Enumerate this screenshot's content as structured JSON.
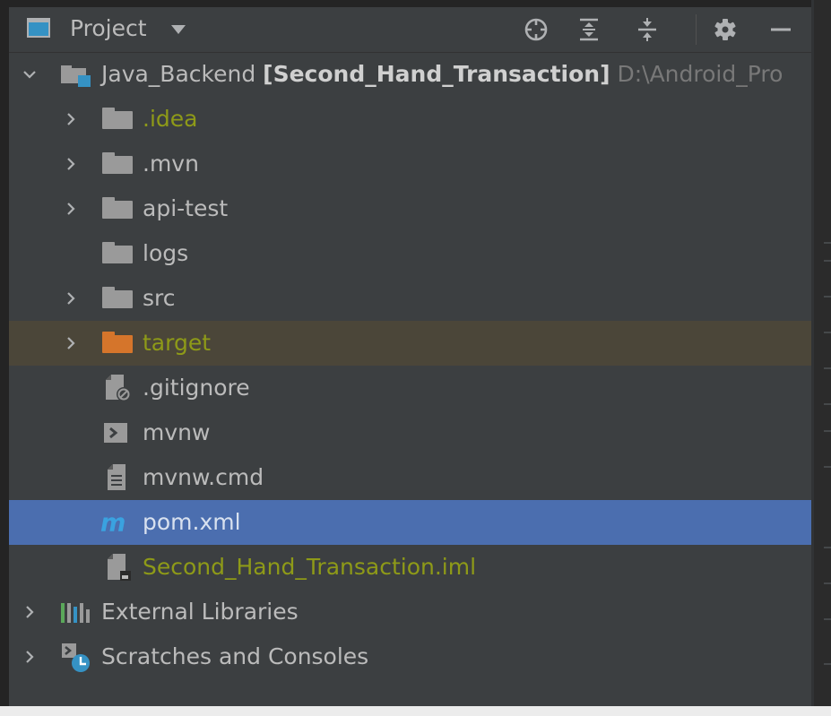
{
  "toolbar": {
    "title": "Project",
    "buttons": [
      {
        "name": "locate-icon"
      },
      {
        "name": "expand-all-icon"
      },
      {
        "name": "collapse-all-icon"
      },
      {
        "name": "gear-icon"
      },
      {
        "name": "minimize-icon"
      }
    ]
  },
  "tree": {
    "root": {
      "name": "Java_Backend",
      "module": "[Second_Hand_Transaction]",
      "path": "D:\\Android_Pro"
    },
    "items": [
      {
        "label": ".idea",
        "type": "folder",
        "expandable": true
      },
      {
        "label": ".mvn",
        "type": "folder",
        "expandable": true
      },
      {
        "label": "api-test",
        "type": "folder",
        "expandable": true
      },
      {
        "label": "logs",
        "type": "folder",
        "expandable": false
      },
      {
        "label": "src",
        "type": "folder",
        "expandable": true
      },
      {
        "label": "target",
        "type": "excluded-folder",
        "expandable": true
      },
      {
        "label": ".gitignore",
        "type": "ignore-file"
      },
      {
        "label": "mvnw",
        "type": "shell-file"
      },
      {
        "label": "mvnw.cmd",
        "type": "text-file"
      },
      {
        "label": "pom.xml",
        "type": "maven-file",
        "selected": true
      },
      {
        "label": "Second_Hand_Transaction.iml",
        "type": "iml-file"
      }
    ],
    "external_libraries": "External Libraries",
    "scratches": "Scratches and Consoles"
  },
  "colors": {
    "panel": "#3c3f41",
    "selection": "#4b6eaf",
    "excluded_row": "#4b4639",
    "untracked_text": "#8e9a18",
    "excluded_folder": "#d5752b",
    "accent_blue": "#3592c4"
  }
}
